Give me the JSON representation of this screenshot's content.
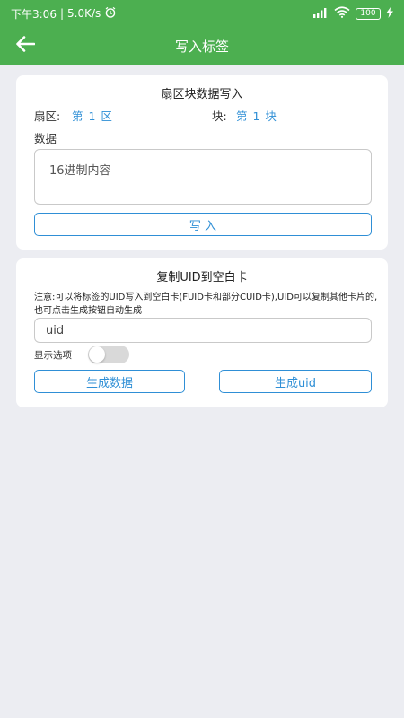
{
  "status_bar": {
    "time": "下午3:06",
    "speed": "5.0K/s",
    "battery": "100",
    "icons": [
      "alarm-icon",
      "signal-icon",
      "wifi-icon",
      "battery-icon",
      "charging-icon"
    ]
  },
  "app_bar": {
    "back_icon": "arrow-left-icon",
    "title": "写入标签"
  },
  "block_write": {
    "title": "扇区块数据写入",
    "sector_label": "扇区:",
    "sector_value": "第 1 区",
    "block_label": "块:",
    "block_value": "第 1 块",
    "data_label": "数据",
    "data_placeholder": "16进制内容",
    "write_button": "写 入"
  },
  "copy_uid": {
    "title": "复制UID到空白卡",
    "note": "注意:可以将标签的UID写入到空白卡(FUID卡和部分CUID卡),UID可以复制其他卡片的,也可点击生成按钮自动生成",
    "uid_placeholder": "uid",
    "show_options_label": "显示选项",
    "show_options_on": false,
    "generate_data_button": "生成数据",
    "generate_uid_button": "生成uid"
  },
  "colors": {
    "primary": "#4caf50",
    "accent": "#2f8fd6",
    "background": "#ecedf2"
  }
}
